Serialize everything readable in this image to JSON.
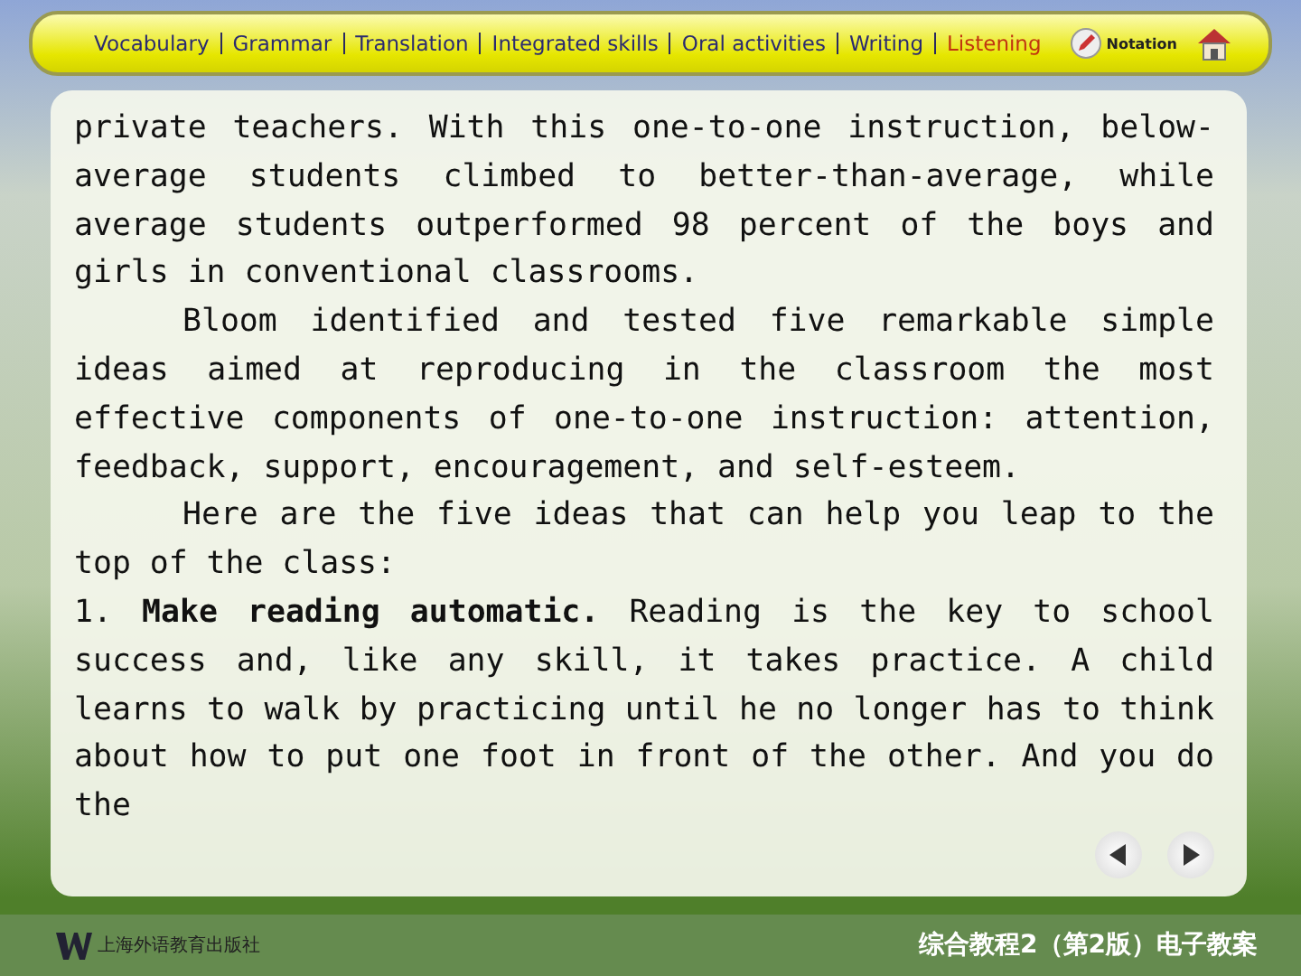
{
  "nav": {
    "items": [
      {
        "label": "Vocabulary",
        "selected": false
      },
      {
        "label": "Grammar",
        "selected": false
      },
      {
        "label": "Translation",
        "selected": false
      },
      {
        "label": "Integrated skills",
        "selected": false
      },
      {
        "label": "Oral activities",
        "selected": false
      },
      {
        "label": "Writing",
        "selected": false
      },
      {
        "label": "Listening",
        "selected": true
      }
    ],
    "notation": "Notation"
  },
  "paragraphs": [
    {
      "indent": false,
      "text": "private teachers. With this one-to-one instruction, below-average students climbed to better-than-average, while average students outperformed 98 percent of the boys and girls in conventional classrooms."
    },
    {
      "indent": true,
      "text": "Bloom identified and tested five remarkable simple ideas aimed at reproducing in the classroom the most effective components of one-to-one instruction: attention, feedback, support, encouragement, and self-esteem."
    },
    {
      "indent": true,
      "text": "Here are the five ideas that can help you leap to the top of the class:"
    },
    {
      "indent": false,
      "text": "1. **Make reading automatic.** Reading is the key to school success and, like any skill, it takes practice. A child learns to walk by practicing until he no longer has to think about how to put one foot in front of the other. And you do the"
    }
  ],
  "footer": {
    "publisher": "上海外语教育出版社",
    "title": "综合教程2（第2版）电子教案"
  }
}
